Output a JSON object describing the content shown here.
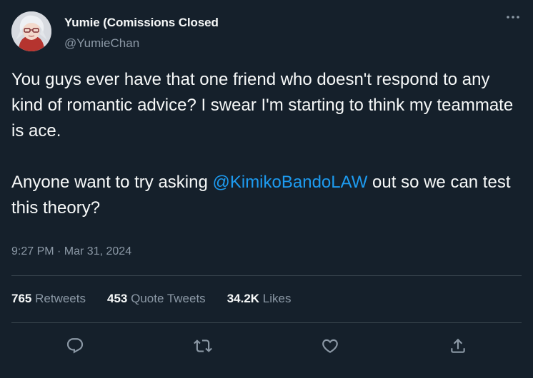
{
  "user": {
    "display_name": "Yumie (Comissions Closed",
    "handle": "@YumieChan"
  },
  "tweet": {
    "line1": "You guys ever have that one friend who doesn't respond to any kind of romantic advice? I swear I'm starting to think my teammate is ace.",
    "line2_before": "Anyone want to try asking ",
    "mention": "@KimikoBandoLAW",
    "line2_after": " out so we can test this theory?",
    "timestamp": "9:27 PM · Mar 31, 2024"
  },
  "stats": {
    "retweets_count": "765",
    "retweets_label": "Retweets",
    "quotes_count": "453",
    "quotes_label": "Quote Tweets",
    "likes_count": "34.2K",
    "likes_label": "Likes"
  },
  "colors": {
    "background": "#15202b",
    "accent": "#1d9bf0",
    "secondary_text": "#8b98a5"
  },
  "icons": {
    "more": "more-dots-icon",
    "reply": "reply-icon",
    "retweet": "retweet-icon",
    "like": "heart-icon",
    "share": "share-icon"
  }
}
